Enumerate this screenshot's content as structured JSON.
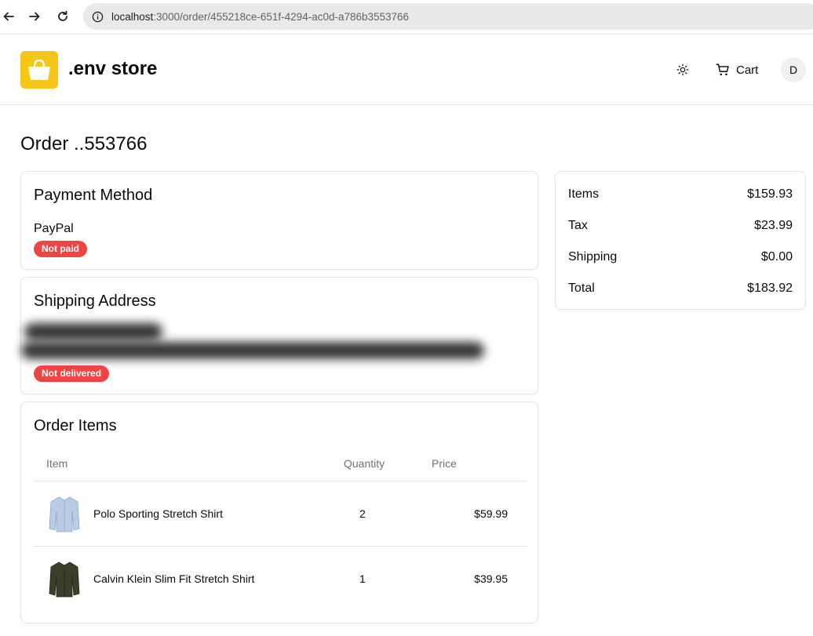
{
  "browser": {
    "url_host": "localhost",
    "url_rest": ":3000/order/455218ce-651f-4294-ac0d-a786b3553766"
  },
  "header": {
    "brand": ".env store",
    "cart_label": "Cart",
    "avatar_initial": "D",
    "logo_color": "#f5c518"
  },
  "page": {
    "title": "Order ..553766"
  },
  "payment": {
    "title": "Payment Method",
    "method": "PayPal",
    "status": "Not paid"
  },
  "shipping": {
    "title": "Shipping Address",
    "status": "Not delivered"
  },
  "order_items": {
    "title": "Order Items",
    "columns": {
      "item": "Item",
      "quantity": "Quantity",
      "price": "Price"
    },
    "rows": [
      {
        "name": "Polo Sporting Stretch Shirt",
        "quantity": "2",
        "price": "$59.99",
        "thumb_color": "#b9cce6"
      },
      {
        "name": "Calvin Klein Slim Fit Stretch Shirt",
        "quantity": "1",
        "price": "$39.95",
        "thumb_color": "#3a3f2a"
      }
    ]
  },
  "summary": {
    "items_label": "Items",
    "items_value": "$159.93",
    "tax_label": "Tax",
    "tax_value": "$23.99",
    "shipping_label": "Shipping",
    "shipping_value": "$0.00",
    "total_label": "Total",
    "total_value": "$183.92"
  },
  "colors": {
    "badge_red": "#ef4444",
    "border": "#e4e4e7",
    "muted_text": "#71717a"
  }
}
